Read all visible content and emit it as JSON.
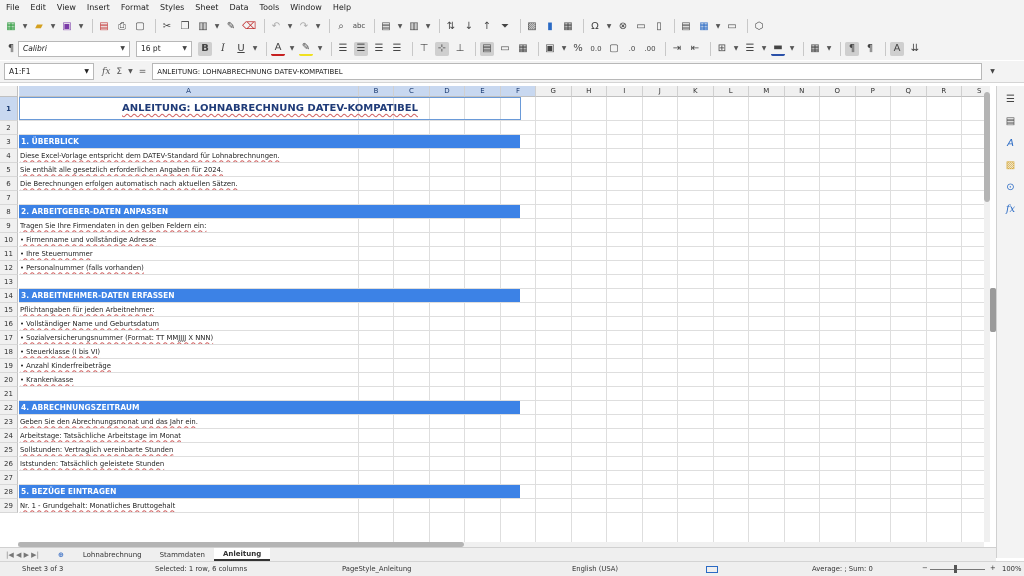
{
  "menubar": [
    "File",
    "Edit",
    "View",
    "Insert",
    "Format",
    "Styles",
    "Sheet",
    "Data",
    "Tools",
    "Window",
    "Help"
  ],
  "toolbar": {
    "font_name": "Calibri",
    "font_size": "16 pt",
    "percent_glyph": "%",
    "currency_glyph": "$",
    "decimal_label": "0.0"
  },
  "formula_bar": {
    "name_box": "A1:F1",
    "fx_symbol": "fx",
    "sum_symbol": "Σ",
    "equals_symbol": "=",
    "content": "ANLEITUNG: LOHNABRECHNUNG DATEV-KOMPATIBEL"
  },
  "columns": [
    "A",
    "B",
    "C",
    "D",
    "E",
    "F",
    "G",
    "H",
    "I",
    "J",
    "K",
    "L",
    "M",
    "N",
    "O",
    "P",
    "Q",
    "R",
    "S"
  ],
  "selected_columns": [
    "A",
    "B",
    "C",
    "D",
    "E",
    "F"
  ],
  "rows": [
    {
      "n": "1",
      "text": "ANLEITUNG: LOHNABRECHNUNG DATEV-KOMPATIBEL",
      "style": "title"
    },
    {
      "n": "2",
      "text": "",
      "style": "normal"
    },
    {
      "n": "3",
      "text": "1. ÜBERBLICK",
      "style": "head"
    },
    {
      "n": "4",
      "text": "Diese Excel-Vorlage entspricht dem DATEV-Standard für Lohnabrechnungen.",
      "style": "normal"
    },
    {
      "n": "5",
      "text": "Sie enthält alle gesetzlich erforderlichen Angaben für 2024.",
      "style": "normal"
    },
    {
      "n": "6",
      "text": "Die Berechnungen erfolgen automatisch nach aktuellen Sätzen.",
      "style": "normal"
    },
    {
      "n": "7",
      "text": "",
      "style": "normal"
    },
    {
      "n": "8",
      "text": "2. ARBEITGEBER-DATEN ANPASSEN",
      "style": "head"
    },
    {
      "n": "9",
      "text": "Tragen Sie Ihre Firmendaten in den gelben Feldern ein:",
      "style": "normal"
    },
    {
      "n": "10",
      "text": "• Firmenname und vollständige Adresse",
      "style": "normal"
    },
    {
      "n": "11",
      "text": "• Ihre Steuernummer",
      "style": "normal"
    },
    {
      "n": "12",
      "text": "• Personalnummer (falls vorhanden)",
      "style": "normal"
    },
    {
      "n": "13",
      "text": "",
      "style": "normal"
    },
    {
      "n": "14",
      "text": "3. ARBEITNEHMER-DATEN ERFASSEN",
      "style": "head"
    },
    {
      "n": "15",
      "text": "Pflichtangaben für jeden Arbeitnehmer:",
      "style": "normal"
    },
    {
      "n": "16",
      "text": "• Vollständiger Name und Geburtsdatum",
      "style": "normal"
    },
    {
      "n": "17",
      "text": "• Sozialversicherungsnummer (Format: TT MMJJJJ X NNN)",
      "style": "normal"
    },
    {
      "n": "18",
      "text": "• Steuerklasse (I bis VI)",
      "style": "normal"
    },
    {
      "n": "19",
      "text": "• Anzahl Kinderfreibeträge",
      "style": "normal"
    },
    {
      "n": "20",
      "text": "• Krankenkasse",
      "style": "normal"
    },
    {
      "n": "21",
      "text": "",
      "style": "normal"
    },
    {
      "n": "22",
      "text": "4. ABRECHNUNGSZEITRAUM",
      "style": "head"
    },
    {
      "n": "23",
      "text": "Geben Sie den Abrechnungsmonat und das Jahr ein.",
      "style": "normal"
    },
    {
      "n": "24",
      "text": "Arbeitstage: Tatsächliche Arbeitstage im Monat",
      "style": "normal"
    },
    {
      "n": "25",
      "text": "Sollstunden: Vertraglich vereinbarte Stunden",
      "style": "normal"
    },
    {
      "n": "26",
      "text": "Iststunden: Tatsächlich geleistete Stunden",
      "style": "normal"
    },
    {
      "n": "27",
      "text": "",
      "style": "normal"
    },
    {
      "n": "28",
      "text": "5. BEZÜGE EINTRAGEN",
      "style": "head"
    },
    {
      "n": "29",
      "text": "Nr. 1 - Grundgehalt: Monatliches Bruttogehalt",
      "style": "normal"
    }
  ],
  "tabs": {
    "add_label": "⊕",
    "items": [
      "Lohnabrechnung",
      "Stammdaten",
      "Anleitung"
    ],
    "active": "Anleitung"
  },
  "status": {
    "sheet": "Sheet 3 of 3",
    "selection": "Selected: 1 row, 6 columns",
    "page_style": "PageStyle_Anleitung",
    "language": "English (USA)",
    "stats": "Average: ; Sum: 0",
    "zoom": "100%"
  },
  "colors": {
    "section_header": "#3c82e6",
    "title_text": "#1f3b78",
    "selection": "#c8d8f0"
  }
}
